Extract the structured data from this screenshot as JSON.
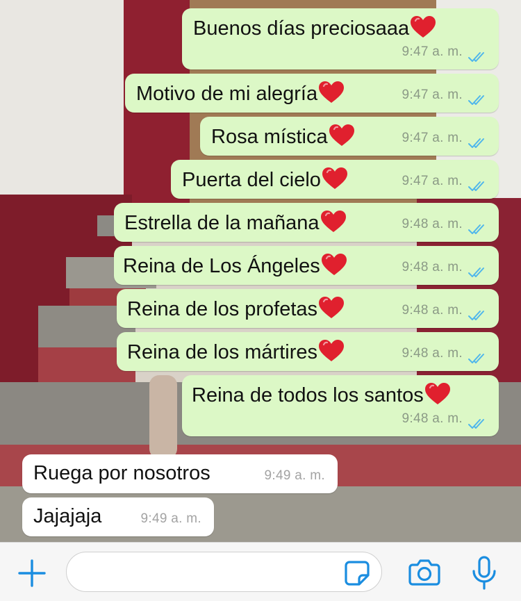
{
  "chat": {
    "messages": [
      {
        "direction": "out",
        "text": "Buenos días preciosaaa",
        "heart": true,
        "time": "9:47 a. m.",
        "read": true
      },
      {
        "direction": "out",
        "text": "Motivo de mi alegría",
        "heart": true,
        "time": "9:47 a. m.",
        "read": true
      },
      {
        "direction": "out",
        "text": "Rosa mística",
        "heart": true,
        "time": "9:47 a. m.",
        "read": true
      },
      {
        "direction": "out",
        "text": "Puerta del cielo",
        "heart": true,
        "time": "9:47 a. m.",
        "read": true
      },
      {
        "direction": "out",
        "text": "Estrella de la mañana",
        "heart": true,
        "time": "9:48 a. m.",
        "read": true
      },
      {
        "direction": "out",
        "text": "Reina de Los Ángeles",
        "heart": true,
        "time": "9:48 a. m.",
        "read": true
      },
      {
        "direction": "out",
        "text": "Reina de los profetas",
        "heart": true,
        "time": "9:48 a. m.",
        "read": true
      },
      {
        "direction": "out",
        "text": "Reina de los mártires",
        "heart": true,
        "time": "9:48 a. m.",
        "read": true
      },
      {
        "direction": "out",
        "text": "Reina de todos los santos",
        "heart": true,
        "time": "9:48 a. m.",
        "read": true
      },
      {
        "direction": "in",
        "text": "Ruega por nosotros",
        "heart": false,
        "time": "9:49 a. m.",
        "read": false
      },
      {
        "direction": "in",
        "text": "Jajajaja",
        "heart": false,
        "time": "9:49 a. m.",
        "read": false
      }
    ]
  },
  "input_bar": {
    "message_value": "",
    "icons": [
      "plus-icon",
      "sticker-icon",
      "camera-icon",
      "microphone-icon"
    ]
  },
  "colors": {
    "outgoing_bubble": "#dcf8c6",
    "incoming_bubble": "#ffffff",
    "read_ticks": "#4fb6ec",
    "accent": "#1a8de0",
    "heart": "#e0202e"
  }
}
